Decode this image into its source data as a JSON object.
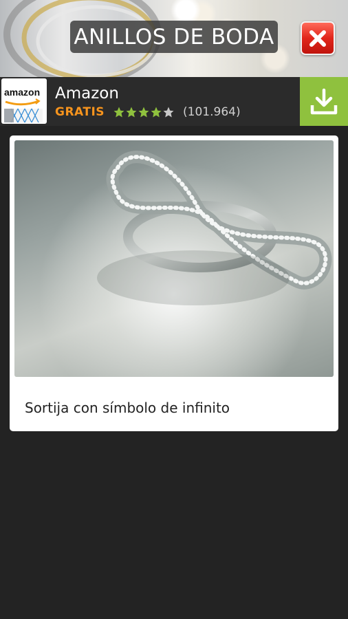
{
  "header": {
    "title": "ANILLOS DE BODA",
    "close_icon": "close-icon"
  },
  "ad": {
    "logo_text": "amazon",
    "app_name": "Amazon",
    "price": "GRATIS",
    "rating": 4,
    "rating_max": 5,
    "review_count": "(101.964)",
    "download_icon": "download-icon",
    "accent_color": "#8fc13e",
    "price_color": "#f7941d"
  },
  "card": {
    "image_icon": "infinity-ring-photo",
    "caption": "Sortija con símbolo de infinito"
  }
}
